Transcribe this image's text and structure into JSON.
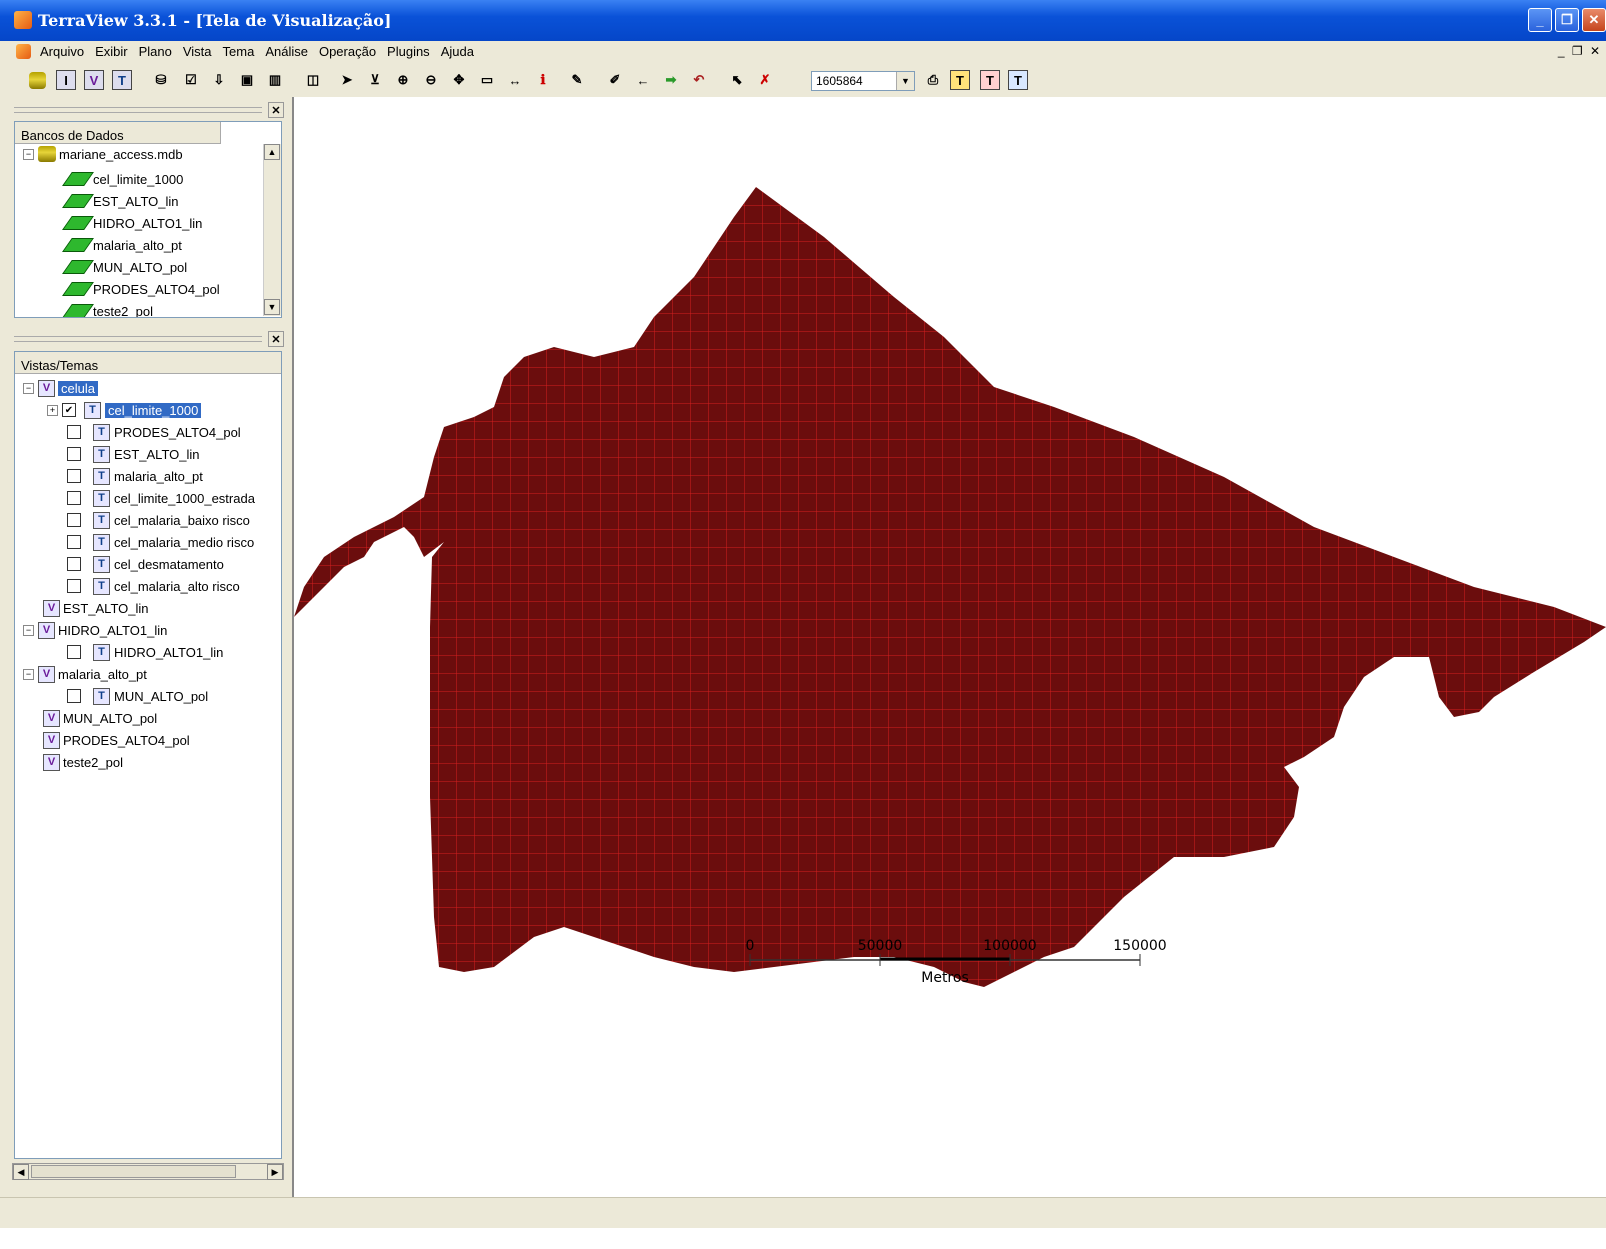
{
  "window": {
    "title": "TerraView 3.3.1 - [Tela de Visualização]"
  },
  "menu": [
    "Arquivo",
    "Exibir",
    "Plano",
    "Vista",
    "Tema",
    "Análise",
    "Operação",
    "Plugins",
    "Ajuda"
  ],
  "toolbar": {
    "scale_value": "1605864"
  },
  "databases": {
    "header": "Bancos de Dados",
    "db_name": "mariane_access.mdb",
    "layers": [
      "cel_limite_1000",
      "EST_ALTO_lin",
      "HIDRO_ALTO1_lin",
      "malaria_alto_pt",
      "MUN_ALTO_pol",
      "PRODES_ALTO4_pol",
      "teste2_pol"
    ]
  },
  "views": {
    "header": "Vistas/Temas",
    "tree": [
      {
        "type": "view",
        "label": "celula",
        "selected": true,
        "expanded": true,
        "themes": [
          {
            "label": "cel_limite_1000",
            "checked": true,
            "selected": true,
            "has_plus": true
          },
          {
            "label": "PRODES_ALTO4_pol",
            "checked": false
          },
          {
            "label": "EST_ALTO_lin",
            "checked": false
          },
          {
            "label": "malaria_alto_pt",
            "checked": false
          },
          {
            "label": "cel_limite_1000_estrada",
            "checked": false
          },
          {
            "label": "cel_malaria_baixo risco",
            "checked": false
          },
          {
            "label": "cel_malaria_medio risco",
            "checked": false
          },
          {
            "label": "cel_desmatamento",
            "checked": false
          },
          {
            "label": "cel_malaria_alto risco",
            "checked": false
          }
        ]
      },
      {
        "type": "view",
        "label": "EST_ALTO_lin"
      },
      {
        "type": "view",
        "label": "HIDRO_ALTO1_lin",
        "expanded": true,
        "themes": [
          {
            "label": "HIDRO_ALTO1_lin",
            "checked": false
          }
        ]
      },
      {
        "type": "view",
        "label": "malaria_alto_pt",
        "expanded": true,
        "themes": [
          {
            "label": "MUN_ALTO_pol",
            "checked": false
          }
        ]
      },
      {
        "type": "view",
        "label": "MUN_ALTO_pol"
      },
      {
        "type": "view",
        "label": "PRODES_ALTO4_pol"
      },
      {
        "type": "view",
        "label": "teste2_pol"
      }
    ]
  },
  "map": {
    "fill_color": "#6b0d0d",
    "grid_color": "#d42020",
    "scalebar": {
      "ticks": [
        "0",
        "50000",
        "100000",
        "150000"
      ],
      "unit": "Metros"
    }
  },
  "colors": {
    "selection": "#316ac5",
    "titlebar": "#0a52d8",
    "chrome": "#ece9d8"
  }
}
